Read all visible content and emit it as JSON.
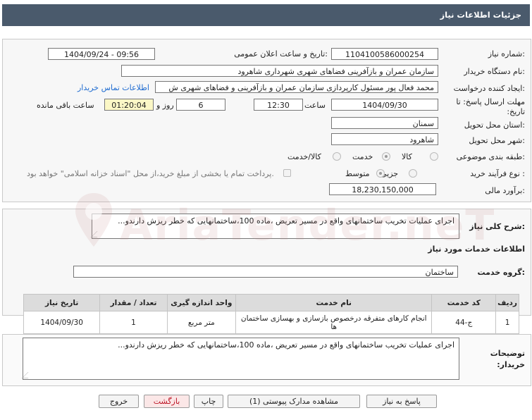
{
  "header": {
    "title": "جزئیات اطلاعات نیاز"
  },
  "form": {
    "need_number_label": "شماره نیاز:",
    "need_number": "1104100586000254",
    "announce_label": "تاریخ و ساعت اعلان عمومی:",
    "announce_value": "1404/09/24 - 09:56",
    "buyer_org_label": "نام دستگاه خریدار:",
    "buyer_org": "سازمان عمران و بازآفرینی فضاهای شهری شهرداری شاهرود",
    "creator_label": "ایجاد کننده درخواست:",
    "creator": "محمد فعال پور مسئول کارپردازی سازمان عمران و بازآفرینی و فضاهای شهری ش",
    "contact_link": "اطلاعات تماس خریدار",
    "deadline_label": "مهلت ارسال پاسخ: تا تاریخ:",
    "deadline_date": "1404/09/30",
    "time_label": "ساعت",
    "deadline_time": "12:30",
    "days": "6",
    "days_label": "روز و",
    "remaining": "01:20:04",
    "remaining_label": "ساعت باقی مانده",
    "province_label": "استان محل تحویل:",
    "province": "سمنان",
    "city_label": "شهر محل تحویل:",
    "city": "شاهرود",
    "category_label": "طبقه بندی موضوعی:",
    "category_options": [
      "کالا",
      "خدمت",
      "کالا/خدمت"
    ],
    "category_selected": "خدمت",
    "process_label": "نوع فرآیند خرید :",
    "process_options": [
      "جزیی",
      "متوسط"
    ],
    "process_selected": "متوسط",
    "payment_note": "پرداخت تمام یا بخشی از مبلغ خرید،از محل \"اسناد خزانه اسلامی\" خواهد بود.",
    "estimate_label": "برآورد مالی:",
    "estimate": "18,230,150,000"
  },
  "summary": {
    "label": "شرح کلی نیاز:",
    "text": "اجرای عملیات تخریب ساختمانهای واقع در مسیر تعریض ،ماده 100،ساختمانهایی که خطر ریزش دارندو...",
    "services_title": "اطلاعات خدمات مورد نیاز",
    "group_label": "گروه خدمت:",
    "group_value": "ساختمان"
  },
  "table": {
    "headers": [
      "ردیف",
      "کد خدمت",
      "نام خدمت",
      "واحد اندازه گیری",
      "تعداد / مقدار",
      "تاریخ نیاز"
    ],
    "rows": [
      [
        "1",
        "ج-44",
        "انجام کارهای متفرقه درخصوص بازسازی و بهسازی ساختمان ها",
        "متر مربع",
        "1",
        "1404/09/30"
      ]
    ]
  },
  "buyer_notes": {
    "label": "توضیحات خریدار:",
    "text": "اجرای عملیات تخریب ساختمانهای واقع در مسیر تعریض ،ماده 100،ساختمانهایی که خطر ریزش دارندو..."
  },
  "buttons": {
    "reply": "پاسخ به نیاز",
    "docs": "مشاهده مدارک پیوستی (1)",
    "print": "چاپ",
    "back": "بازگشت",
    "exit": "خروج"
  },
  "watermark": "AriaTender.neT"
}
